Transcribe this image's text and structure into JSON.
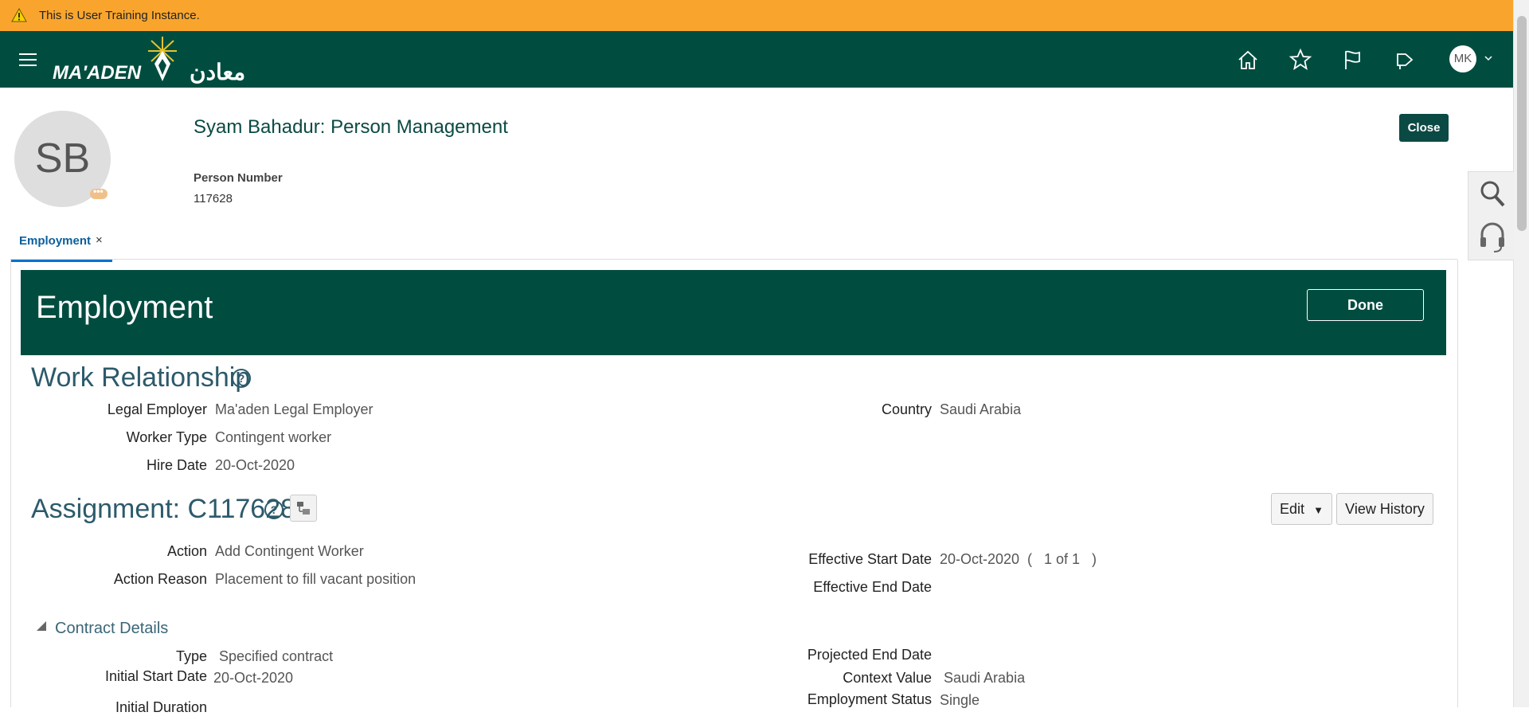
{
  "banner": {
    "text": "This is User Training Instance."
  },
  "header": {
    "logo_text": "MA'ADEN",
    "logo_arabic": "معادن",
    "user_initials": "MK"
  },
  "person": {
    "initials": "SB",
    "title": "Syam Bahadur: Person Management",
    "number_label": "Person Number",
    "number_value": "117628",
    "close_label": "Close"
  },
  "tabs": [
    {
      "label": "Employment",
      "close": "×"
    }
  ],
  "employment": {
    "title": "Employment",
    "done_label": "Done"
  },
  "work_relationship": {
    "title": "Work Relationship",
    "legal_employer_label": "Legal Employer",
    "legal_employer_value": "Ma'aden Legal Employer",
    "worker_type_label": "Worker Type",
    "worker_type_value": "Contingent worker",
    "hire_date_label": "Hire Date",
    "hire_date_value": "20-Oct-2020",
    "country_label": "Country",
    "country_value": "Saudi Arabia"
  },
  "assignment": {
    "title": "Assignment: C117628",
    "edit_label": "Edit",
    "view_history_label": "View History",
    "action_label": "Action",
    "action_value": "Add Contingent Worker",
    "action_reason_label": "Action Reason",
    "action_reason_value": "Placement to fill vacant position",
    "effective_start_label": "Effective Start Date",
    "effective_start_value": "20-Oct-2020",
    "record_counter": "(   1 of 1   )",
    "effective_end_label": "Effective End Date"
  },
  "contract": {
    "title": "Contract Details",
    "type_label": "Type",
    "type_value": "Specified contract",
    "initial_start_label": "Initial Start Date",
    "initial_start_value": "20-Oct-2020",
    "initial_duration_label": "Initial Duration",
    "projected_end_label": "Projected End Date",
    "context_value_label": "Context Value",
    "context_value_value": "Saudi Arabia",
    "employment_status_label": "Employment Status",
    "employment_status_value": "Single"
  }
}
